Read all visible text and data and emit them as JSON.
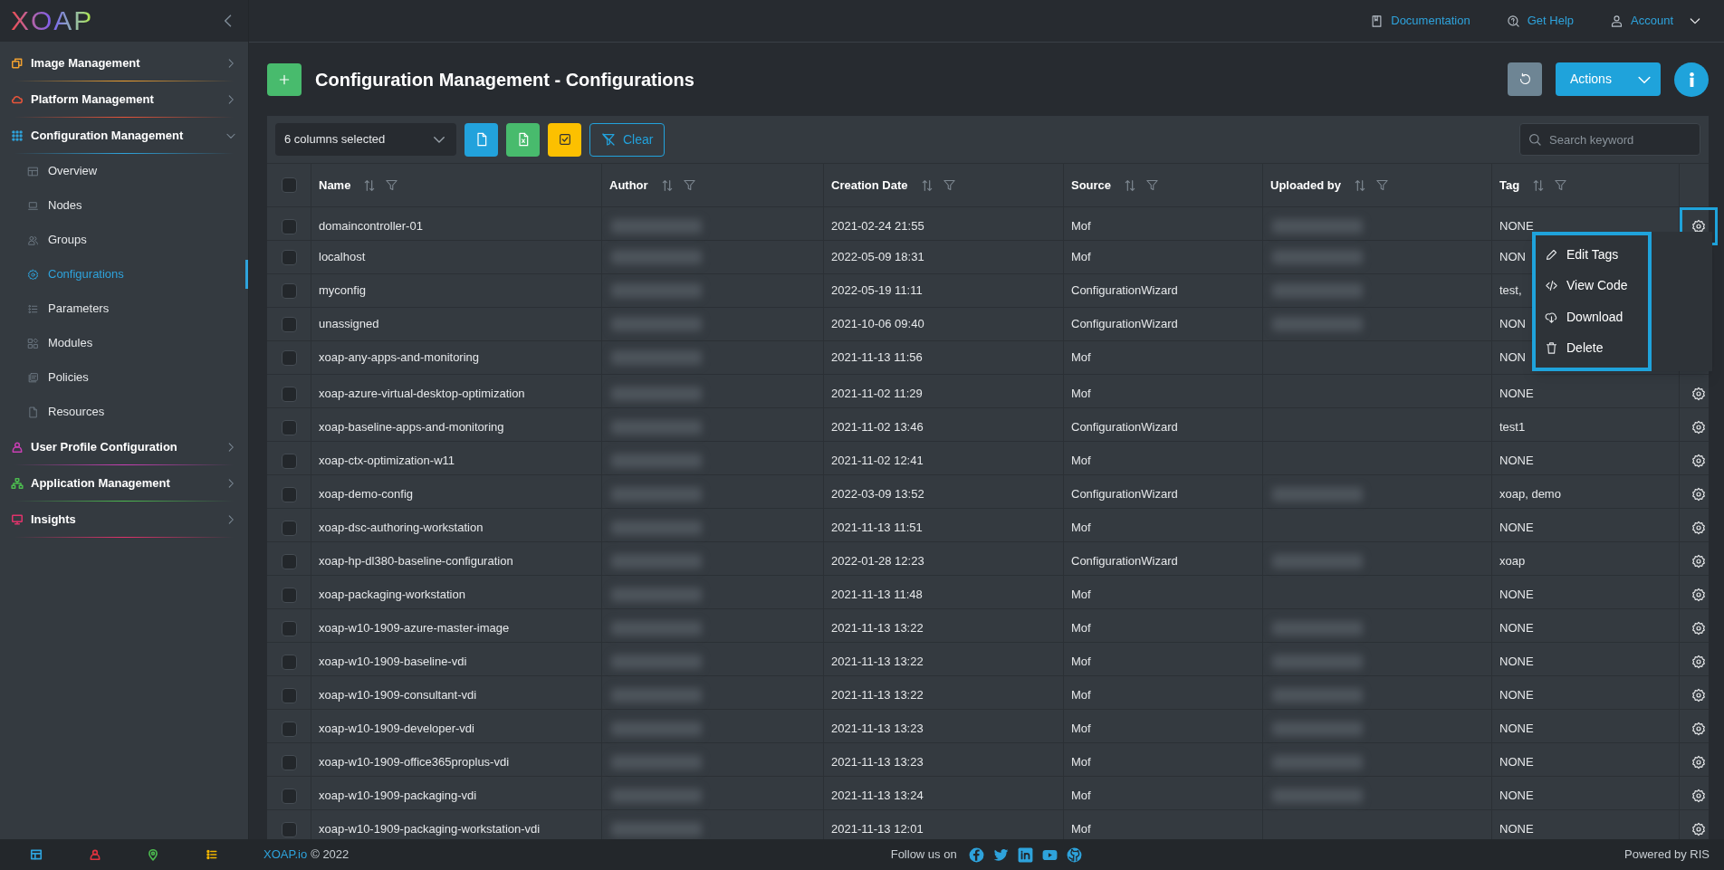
{
  "logo": "XOAP",
  "sidebar": {
    "sections": [
      {
        "label": "Image Management",
        "color": "#f0a030",
        "expanded": false
      },
      {
        "label": "Platform Management",
        "color": "#e8553a",
        "expanded": false
      },
      {
        "label": "Configuration Management",
        "color": "#2ea3dc",
        "expanded": true,
        "children": [
          {
            "label": "Overview",
            "selected": false
          },
          {
            "label": "Nodes",
            "selected": false
          },
          {
            "label": "Groups",
            "selected": false
          },
          {
            "label": "Configurations",
            "selected": true
          },
          {
            "label": "Parameters",
            "selected": false
          },
          {
            "label": "Modules",
            "selected": false
          },
          {
            "label": "Policies",
            "selected": false
          },
          {
            "label": "Resources",
            "selected": false
          }
        ]
      },
      {
        "label": "User Profile Configuration",
        "color": "#c93fb4",
        "expanded": false
      },
      {
        "label": "Application Management",
        "color": "#4cba4f",
        "expanded": false
      },
      {
        "label": "Insights",
        "color": "#e0336b",
        "expanded": false
      }
    ],
    "bottom_icons": [
      {
        "color": "#2ea3dc"
      },
      {
        "color": "#e0333f"
      },
      {
        "color": "#4cba4f"
      },
      {
        "color": "#f0b400"
      }
    ]
  },
  "top_links": [
    "Documentation",
    "Get Help",
    "Account"
  ],
  "page_title": "Configuration Management - Configurations",
  "actions_button": "Actions",
  "toolbar": {
    "columns_select": "6 columns selected",
    "clear_button": "Clear",
    "search_placeholder": "Search keyword"
  },
  "table": {
    "all_checked": false,
    "columns": [
      "Name",
      "Author",
      "Creation Date",
      "Source",
      "Uploaded by",
      "Tag"
    ],
    "rows": [
      {
        "name": "domaincontroller-01",
        "date": "2021-02-24 21:55",
        "source": "Mof",
        "tag": "NONE",
        "uploaded_redacted": true,
        "checked": false,
        "menu_open": true
      },
      {
        "name": "localhost",
        "date": "2022-05-09 18:31",
        "source": "Mof",
        "tag": "NON",
        "uploaded_redacted": true,
        "checked": false,
        "menu_open": false
      },
      {
        "name": "myconfig",
        "date": "2022-05-19 11:11",
        "source": "ConfigurationWizard",
        "tag": "test,",
        "uploaded_redacted": true,
        "checked": false,
        "menu_open": false
      },
      {
        "name": "unassigned",
        "date": "2021-10-06 09:40",
        "source": "ConfigurationWizard",
        "tag": "NON",
        "uploaded_redacted": true,
        "checked": false,
        "menu_open": false
      },
      {
        "name": "xoap-any-apps-and-monitoring",
        "date": "2021-11-13 11:56",
        "source": "Mof",
        "tag": "NON",
        "uploaded_redacted": false,
        "checked": false,
        "menu_open": false
      },
      {
        "name": "xoap-azure-virtual-desktop-optimization",
        "date": "2021-11-02 11:29",
        "source": "Mof",
        "tag": "NONE",
        "uploaded_redacted": false,
        "checked": false,
        "menu_open": false
      },
      {
        "name": "xoap-baseline-apps-and-monitoring",
        "date": "2021-11-02 13:46",
        "source": "ConfigurationWizard",
        "tag": "test1",
        "uploaded_redacted": false,
        "checked": false,
        "menu_open": false
      },
      {
        "name": "xoap-ctx-optimization-w11",
        "date": "2021-11-02 12:41",
        "source": "Mof",
        "tag": "NONE",
        "uploaded_redacted": false,
        "checked": false,
        "menu_open": false
      },
      {
        "name": "xoap-demo-config",
        "date": "2022-03-09 13:52",
        "source": "ConfigurationWizard",
        "tag": "xoap, demo",
        "uploaded_redacted": true,
        "checked": false,
        "menu_open": false
      },
      {
        "name": "xoap-dsc-authoring-workstation",
        "date": "2021-11-13 11:51",
        "source": "Mof",
        "tag": "NONE",
        "uploaded_redacted": false,
        "checked": false,
        "menu_open": false
      },
      {
        "name": "xoap-hp-dl380-baseline-configuration",
        "date": "2022-01-28 12:23",
        "source": "ConfigurationWizard",
        "tag": "xoap",
        "uploaded_redacted": true,
        "checked": false,
        "menu_open": false
      },
      {
        "name": "xoap-packaging-workstation",
        "date": "2021-11-13 11:48",
        "source": "Mof",
        "tag": "NONE",
        "uploaded_redacted": false,
        "checked": false,
        "menu_open": false
      },
      {
        "name": "xoap-w10-1909-azure-master-image",
        "date": "2021-11-13 13:22",
        "source": "Mof",
        "tag": "NONE",
        "uploaded_redacted": true,
        "checked": false,
        "menu_open": false
      },
      {
        "name": "xoap-w10-1909-baseline-vdi",
        "date": "2021-11-13 13:22",
        "source": "Mof",
        "tag": "NONE",
        "uploaded_redacted": true,
        "checked": false,
        "menu_open": false
      },
      {
        "name": "xoap-w10-1909-consultant-vdi",
        "date": "2021-11-13 13:22",
        "source": "Mof",
        "tag": "NONE",
        "uploaded_redacted": true,
        "checked": false,
        "menu_open": false
      },
      {
        "name": "xoap-w10-1909-developer-vdi",
        "date": "2021-11-13 13:23",
        "source": "Mof",
        "tag": "NONE",
        "uploaded_redacted": true,
        "checked": false,
        "menu_open": false
      },
      {
        "name": "xoap-w10-1909-office365proplus-vdi",
        "date": "2021-11-13 13:23",
        "source": "Mof",
        "tag": "NONE",
        "uploaded_redacted": true,
        "checked": false,
        "menu_open": false
      },
      {
        "name": "xoap-w10-1909-packaging-vdi",
        "date": "2021-11-13 13:24",
        "source": "Mof",
        "tag": "NONE",
        "uploaded_redacted": true,
        "checked": false,
        "menu_open": false
      },
      {
        "name": "xoap-w10-1909-packaging-workstation-vdi",
        "date": "2021-11-13 12:01",
        "source": "Mof",
        "tag": "NONE",
        "uploaded_redacted": false,
        "checked": false,
        "menu_open": false
      }
    ]
  },
  "row_menu": [
    "Edit Tags",
    "View Code",
    "Download",
    "Delete"
  ],
  "footer": {
    "brand": "XOAP.io",
    "copyright": "© 2022",
    "follow": "Follow us on",
    "powered": "Powered by RIS"
  }
}
